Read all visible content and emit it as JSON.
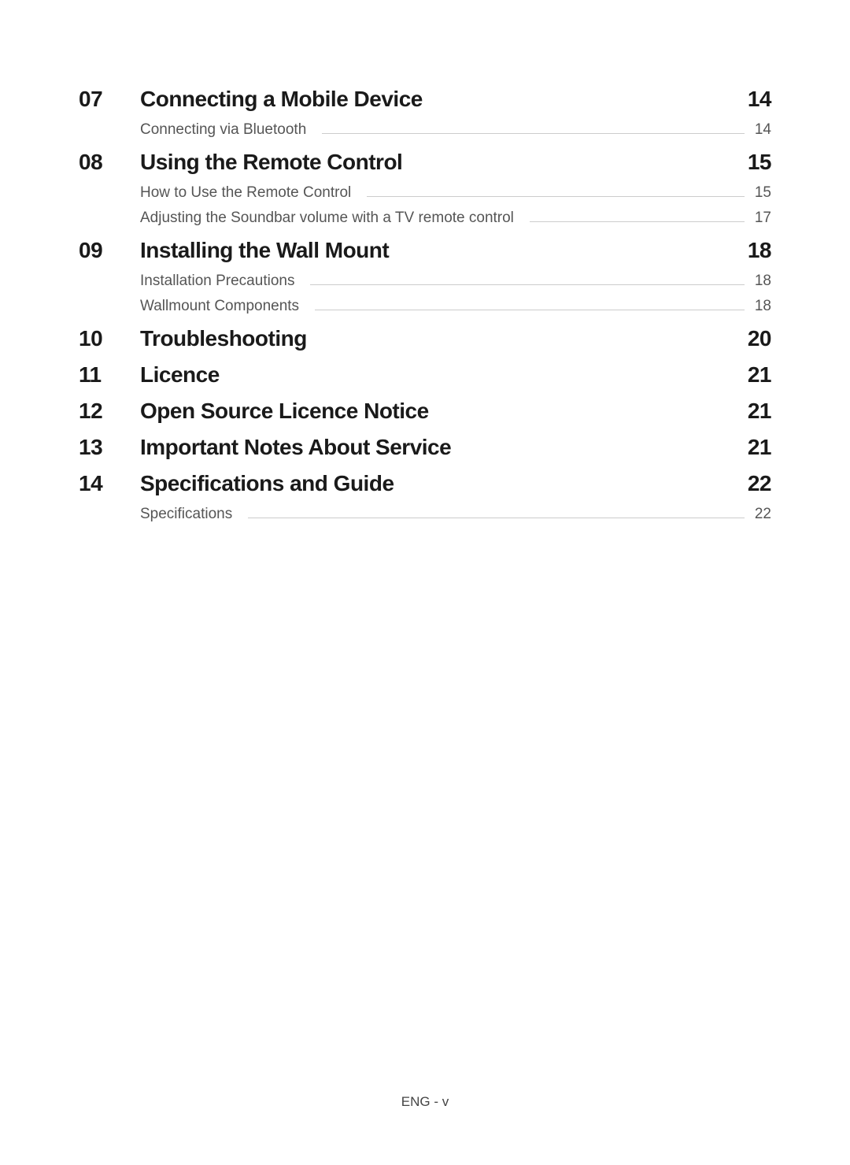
{
  "sections": [
    {
      "number": "07",
      "title": "Connecting a Mobile Device",
      "page": "14",
      "subs": [
        {
          "title": "Connecting via Bluetooth",
          "page": "14"
        }
      ]
    },
    {
      "number": "08",
      "title": "Using the Remote Control",
      "page": "15",
      "subs": [
        {
          "title": "How to Use the Remote Control",
          "page": "15"
        },
        {
          "title": "Adjusting the Soundbar volume with a TV remote control",
          "page": "17"
        }
      ]
    },
    {
      "number": "09",
      "title": "Installing the Wall Mount",
      "page": "18",
      "subs": [
        {
          "title": "Installation Precautions",
          "page": "18"
        },
        {
          "title": "Wallmount Components",
          "page": "18"
        }
      ]
    },
    {
      "number": "10",
      "title": "Troubleshooting",
      "page": "20",
      "subs": []
    },
    {
      "number": "11",
      "title": "Licence",
      "page": "21",
      "subs": []
    },
    {
      "number": "12",
      "title": "Open Source Licence Notice",
      "page": "21",
      "subs": []
    },
    {
      "number": "13",
      "title": "Important Notes About Service",
      "page": "21",
      "subs": []
    },
    {
      "number": "14",
      "title": "Specifications and Guide",
      "page": "22",
      "subs": [
        {
          "title": "Specifications",
          "page": "22"
        }
      ]
    }
  ],
  "footer": "ENG - v"
}
